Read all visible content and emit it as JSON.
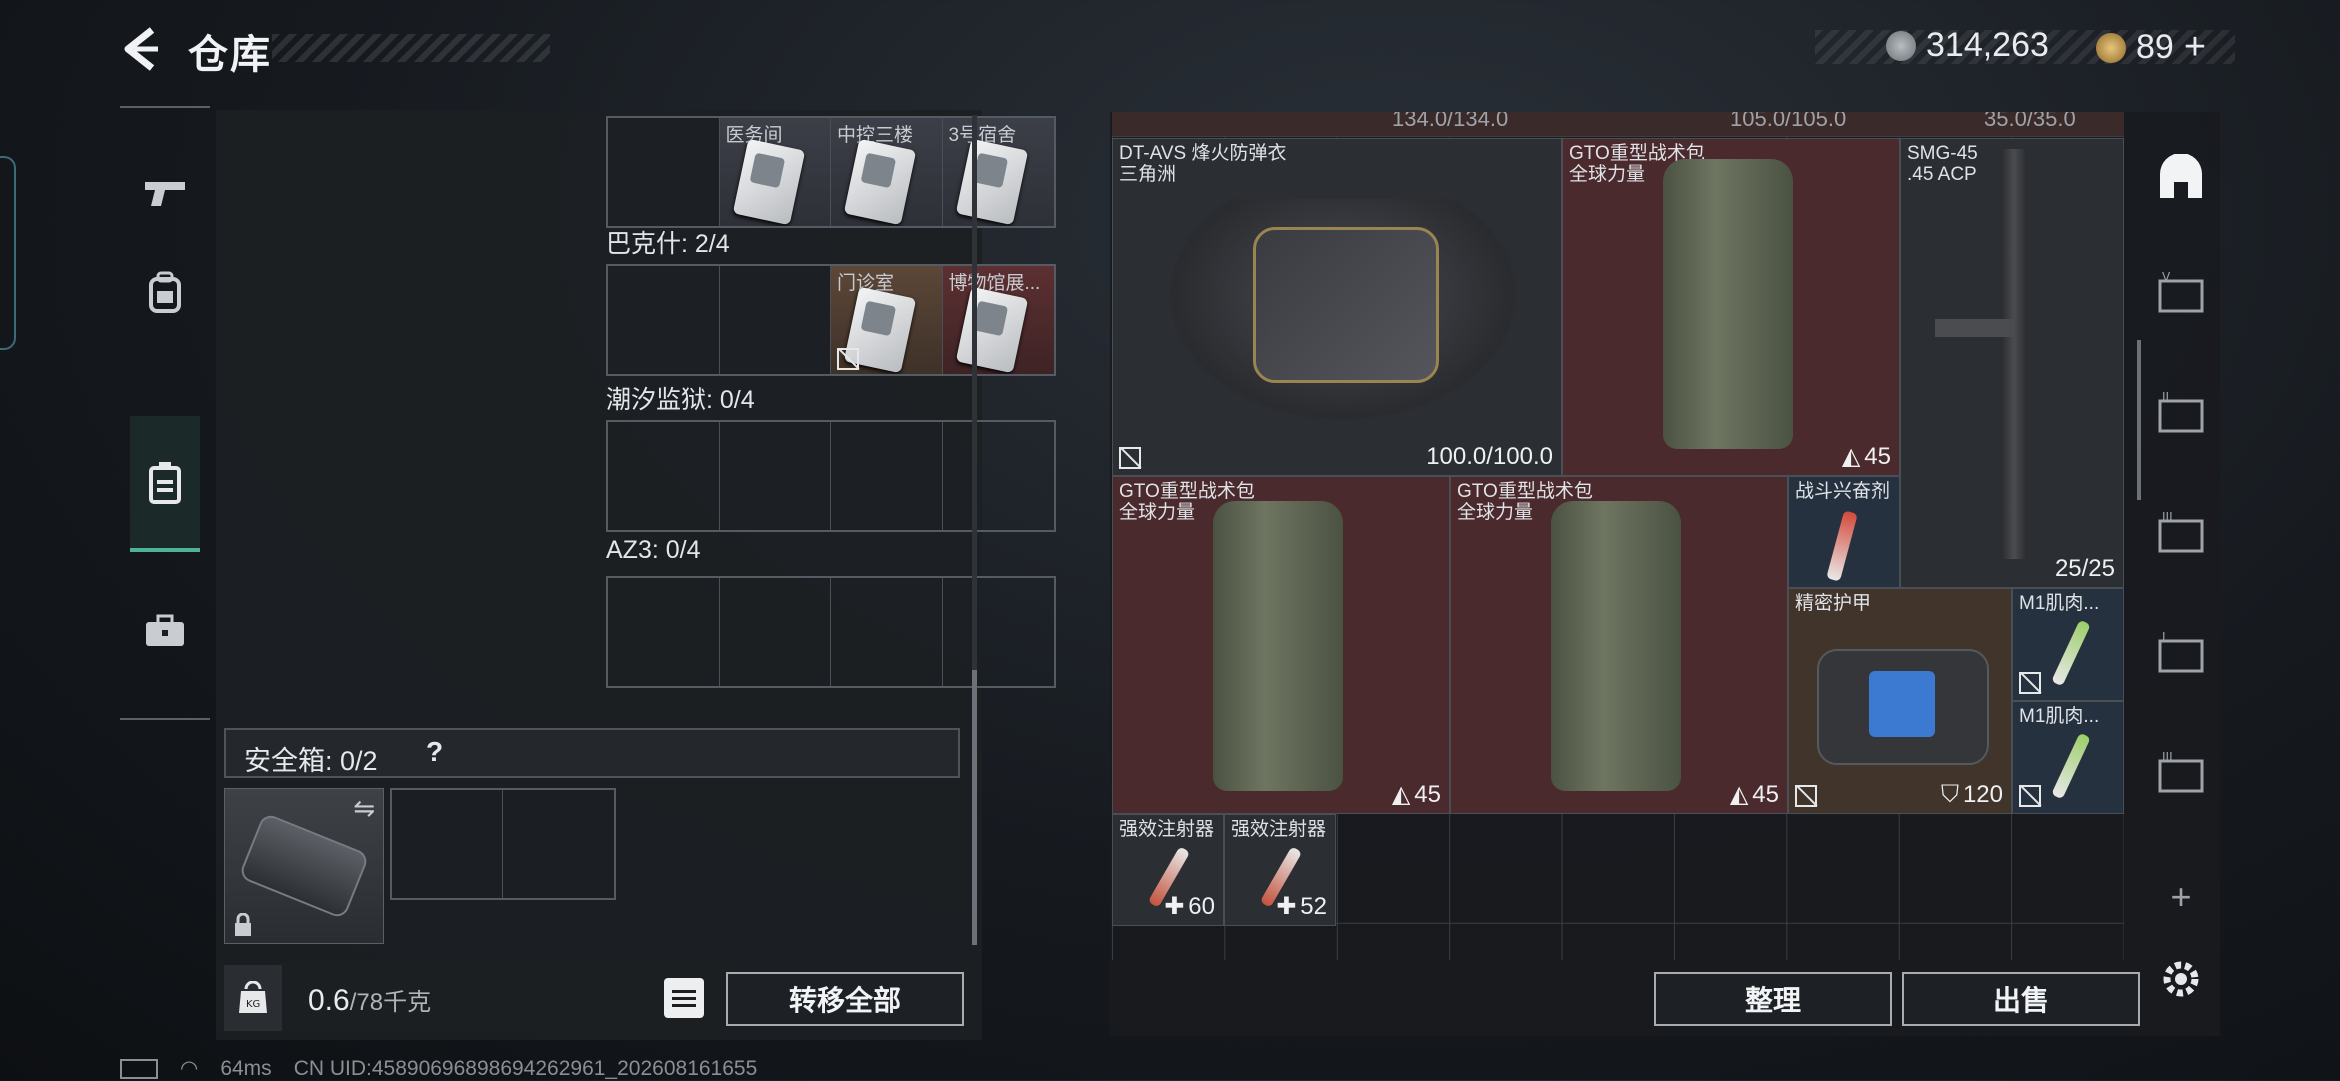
{
  "header": {
    "title": "仓库",
    "coins": "314,263",
    "tokens": "89"
  },
  "left_nav": [
    {
      "name": "weapon"
    },
    {
      "name": "backpack"
    },
    {
      "name": "keycard",
      "active": true
    },
    {
      "name": "toolbox"
    }
  ],
  "key_groups": [
    {
      "label": "",
      "slots": [
        {
          "label": ""
        },
        {
          "label": "医务间"
        },
        {
          "label": "中控三楼"
        },
        {
          "label": "3号宿舍"
        }
      ]
    },
    {
      "label": "巴克什: 2/4",
      "slots": [
        {
          "label": ""
        },
        {
          "label": ""
        },
        {
          "label": "门诊室"
        },
        {
          "label": "博物馆展..."
        }
      ]
    },
    {
      "label": "潮汐监狱: 0/4"
    },
    {
      "label": "AZ3: 0/4"
    }
  ],
  "safebox": {
    "label": "安全箱: 0/2",
    "help": "?"
  },
  "weight": {
    "current": "0.6",
    "max": "/78千克"
  },
  "buttons": {
    "transfer_all": "转移全部",
    "organize": "整理",
    "sell": "出售"
  },
  "top_strip": [
    "134.0/134.0",
    "105.0/105.0",
    "35.0/35.0"
  ],
  "items": {
    "armor": {
      "name": "DT-AVS 烽火防弹衣",
      "sub": "三角洲",
      "value": "100.0/100.0"
    },
    "pack1": {
      "name": "GTO重型战术包",
      "sub": "全球力量",
      "value": "45"
    },
    "smg": {
      "name": "SMG-45",
      "sub": ".45 ACP",
      "value": "25/25"
    },
    "pack2": {
      "name": "GTO重型战术包",
      "sub": "全球力量",
      "value": "45"
    },
    "pack3": {
      "name": "GTO重型战术包",
      "sub": "全球力量",
      "value": "45"
    },
    "stim": {
      "name": "战斗兴奋剂"
    },
    "case": {
      "name": "精密护甲",
      "value": "120"
    },
    "m1a": {
      "name": "M1肌肉..."
    },
    "m1b": {
      "name": "M1肌肉..."
    },
    "inj1": {
      "name": "强效注射器",
      "value": "60"
    },
    "inj2": {
      "name": "强效注射器",
      "value": "52"
    }
  },
  "footer": {
    "ping": "64ms",
    "uid": "CN UID:45890696898694262961_202608161655"
  },
  "colors": {
    "accent": "#4fb29a",
    "red_tile": "#4a2a2d",
    "blue_tile": "#26313f"
  }
}
